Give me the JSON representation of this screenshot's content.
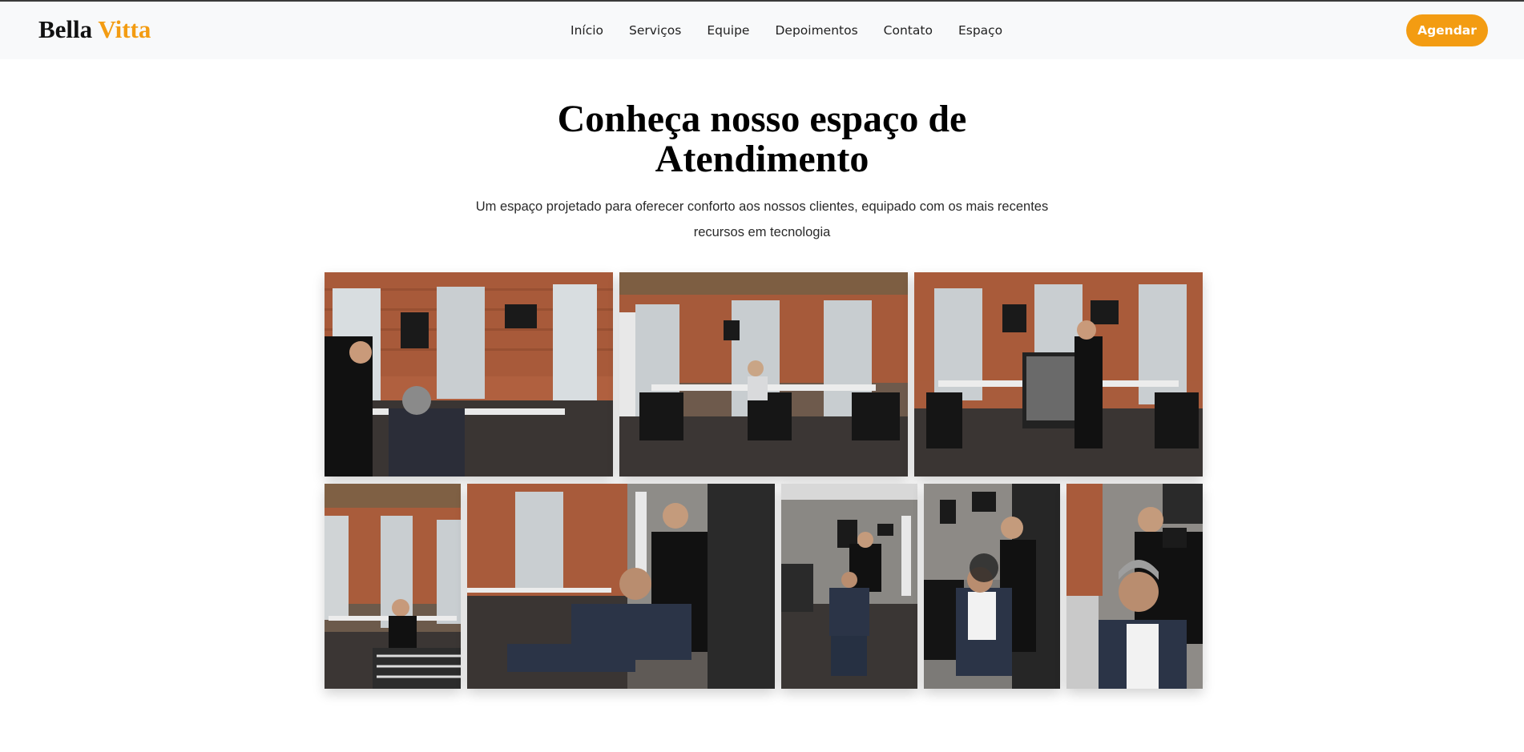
{
  "brand": {
    "part1": "Bella",
    "part2": "Vitta"
  },
  "nav": {
    "items": [
      "Início",
      "Serviços",
      "Equipe",
      "Depoimentos",
      "Contato",
      "Espaço"
    ]
  },
  "cta_label": "Agendar",
  "hero": {
    "title_line1": "Conheça nosso espaço de",
    "title_line2": "Atendimento",
    "subtitle_line1": "Um espaço projetado para oferecer conforto aos nossos clientes, equipado com os mais recentes",
    "subtitle_line2": "recursos em tecnologia"
  },
  "colors": {
    "accent": "#f39c12",
    "header_bg": "#f8f9fa"
  },
  "gallery": {
    "photo_count": 8
  }
}
